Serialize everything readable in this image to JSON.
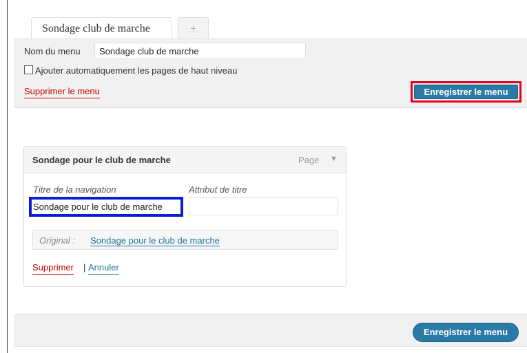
{
  "tabs": {
    "active_label": "Sondage club de marche",
    "add_label": "+"
  },
  "menu_header": {
    "name_label": "Nom du menu",
    "name_value": "Sondage club de marche",
    "auto_add_label": "Ajouter automatiquement les pages de haut niveau",
    "auto_add_checked": false,
    "delete_menu_label": "Supprimer le menu",
    "save_label": "Enregistrer le menu"
  },
  "menu_item": {
    "title": "Sondage pour le club de marche",
    "type_label": "Page",
    "arrow": "▼",
    "nav_label_caption": "Titre de la navigation",
    "nav_label_value": "Sondage pour le club de marche",
    "title_attr_caption": "Attribut de titre",
    "title_attr_value": "",
    "original_caption": "Original :",
    "original_link": "Sondage pour le club de marche",
    "delete_label": "Supprimer",
    "separator": "|",
    "cancel_label": "Annuler"
  },
  "menu_footer": {
    "save_label": "Enregistrer le menu"
  },
  "colors": {
    "accent_button": "#2a7aa6",
    "delete_red": "#cc0000",
    "link_blue": "#21759b",
    "highlight_red": "#e3001b",
    "highlight_blue": "#0d1bd8"
  }
}
